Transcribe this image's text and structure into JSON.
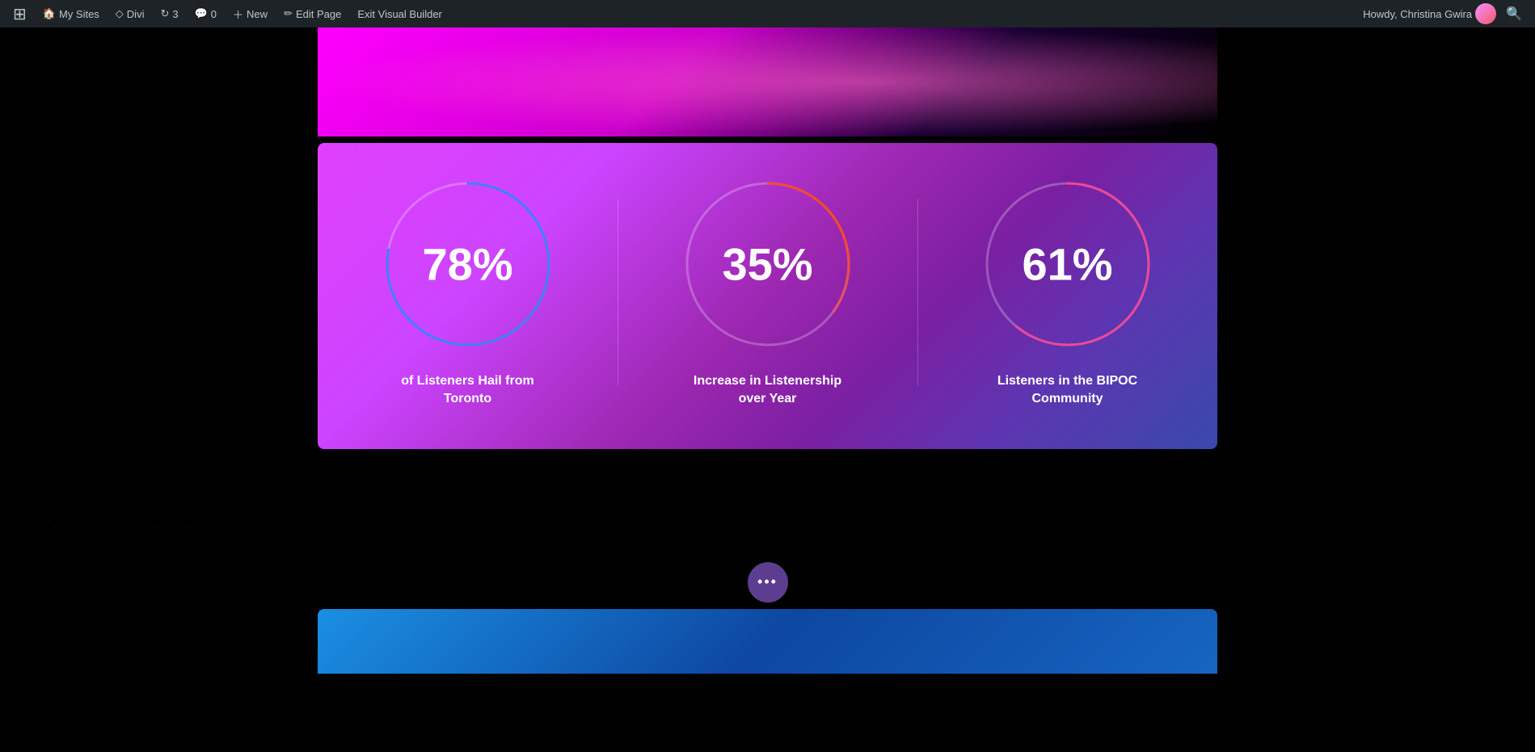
{
  "adminBar": {
    "wpLogo": "⊞",
    "mySites": "My Sites",
    "divi": "Divi",
    "updates": "3",
    "comments": "0",
    "new": "New",
    "editPage": "Edit Page",
    "exitVisualBuilder": "Exit Visual Builder",
    "howdy": "Howdy, Christina Gwira",
    "searchIcon": "🔍"
  },
  "stats": [
    {
      "id": "stat-toronto",
      "value": "78%",
      "label": "of Listeners Hail from Toronto",
      "percent": 78,
      "strokeColor": "#3b82f6",
      "circumference": 660,
      "gradientId": null
    },
    {
      "id": "stat-listenership",
      "value": "35%",
      "label": "Increase in Listenership over Year",
      "percent": 35,
      "strokeColor": "url(#grad2)",
      "circumference": 660,
      "gradientId": "grad2",
      "gradientStart": "#cc66ff",
      "gradientEnd": "#ff4500"
    },
    {
      "id": "stat-bipoc",
      "value": "61%",
      "label": "Listeners in the BIPOC Community",
      "percent": 61,
      "strokeColor": "#ec4899",
      "circumference": 660,
      "gradientId": null
    }
  ],
  "floatingDotsLabel": "•••"
}
